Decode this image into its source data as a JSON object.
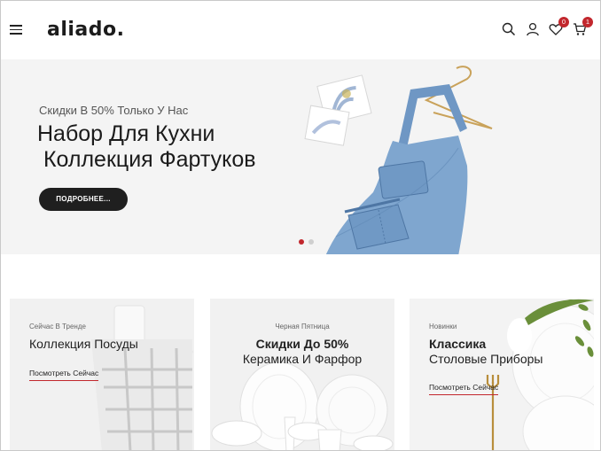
{
  "header": {
    "logo": "aliado.",
    "wishlist_count": "0",
    "cart_count": "1",
    "icons": [
      "menu-icon",
      "search-icon",
      "user-icon",
      "heart-icon",
      "cart-icon"
    ]
  },
  "hero": {
    "subtitle": "Скидки В  50% Только У Нас",
    "title_line1": "Набор Для Кухни",
    "title_line2": " Коллекция Фартуков",
    "button_label": "ПОДРОБНЕЕ...",
    "slides_total": 2,
    "active_slide": 1
  },
  "cards": [
    {
      "eyebrow": "Сейчас В Тренде",
      "title": "Коллекция Посуды",
      "subtitle": "",
      "link": "Посмотреть Сейчас"
    },
    {
      "eyebrow": "Черная Пятница",
      "title": "Скидки До 50%",
      "subtitle": "Керамика И Фарфор",
      "link": ""
    },
    {
      "eyebrow": "Новинки",
      "title": "Классика",
      "subtitle": "Столовые Приборы",
      "link": "Посмотреть Сейчас"
    }
  ],
  "colors": {
    "accent": "#c2272d",
    "dark": "#1f1f1f",
    "hero_bg": "#f4f4f4",
    "apron": "#7fa6cf"
  }
}
